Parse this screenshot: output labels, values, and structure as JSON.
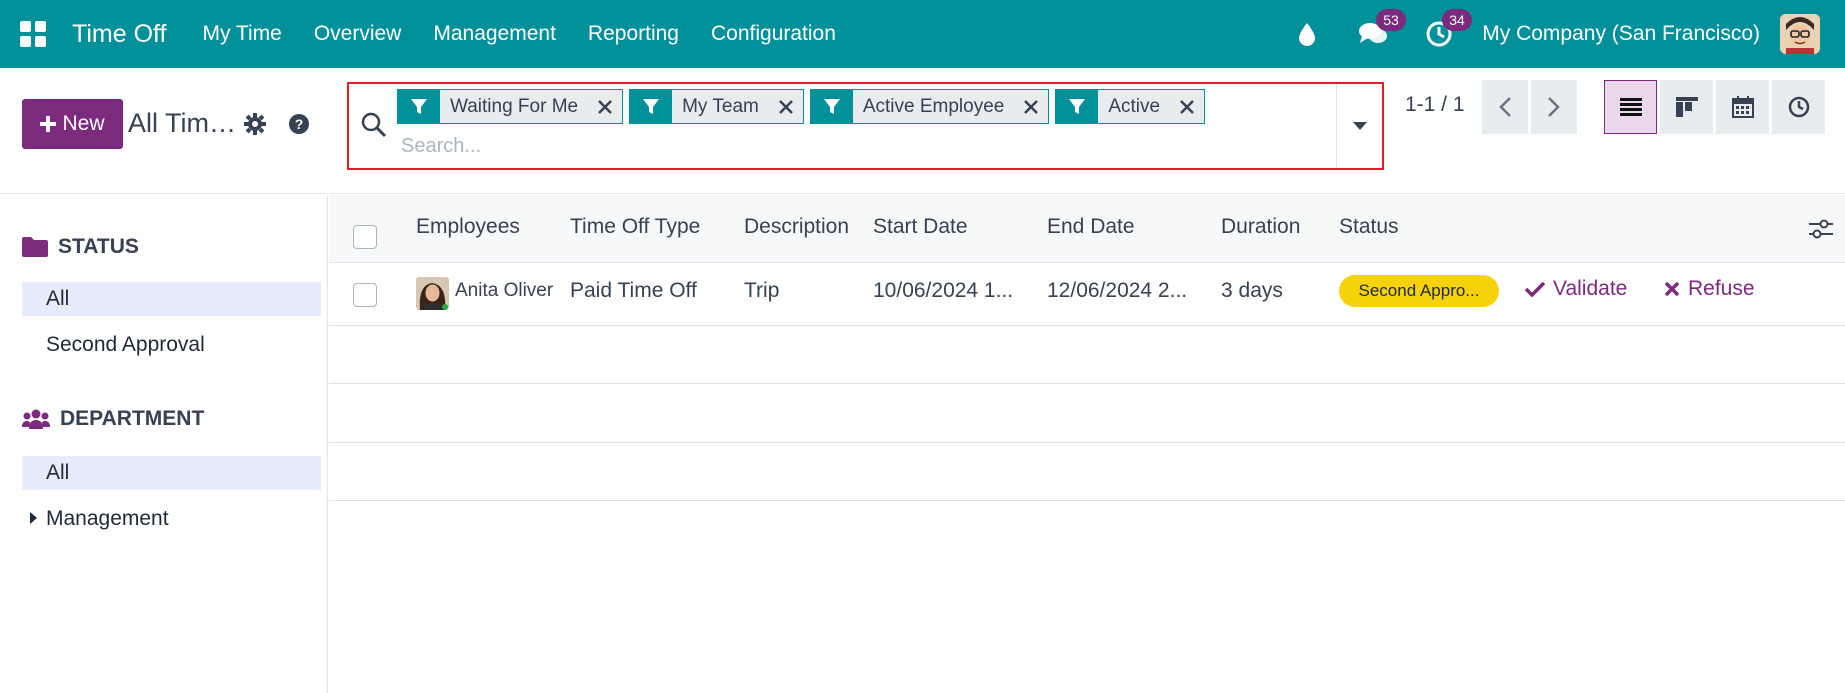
{
  "navbar": {
    "app_name": "Time Off",
    "menu": [
      "My Time",
      "Overview",
      "Management",
      "Reporting",
      "Configuration"
    ],
    "messages_count": "53",
    "activities_count": "34",
    "company": "My Company (San Francisco)",
    "icons": [
      "apps-grid-icon",
      "droplet-icon",
      "chat-icon",
      "clock-icon"
    ]
  },
  "control": {
    "new_label": "New",
    "breadcrumb": "All Time Off",
    "search": {
      "facets": [
        "Waiting For Me",
        "My Team",
        "Active Employee",
        "Active"
      ],
      "placeholder": "Search..."
    },
    "pager": "1-1 / 1"
  },
  "sidepanel": {
    "status_title": "STATUS",
    "status_items": [
      "All",
      "Second Approval"
    ],
    "department_title": "DEPARTMENT",
    "department_items": [
      "All",
      "Management"
    ]
  },
  "list": {
    "columns": [
      "Employees",
      "Time Off Type",
      "Description",
      "Start Date",
      "End Date",
      "Duration",
      "Status"
    ],
    "rows": [
      {
        "employee": "Anita Oliver",
        "type": "Paid Time Off",
        "description": "Trip",
        "start": "10/06/2024 1...",
        "end": "12/06/2024 2...",
        "duration": "3 days",
        "status": "Second Appro...",
        "validate_label": "Validate",
        "refuse_label": "Refuse"
      }
    ]
  },
  "colors": {
    "navbar": "#00909a",
    "primary": "#7c2a7e",
    "status_badge": "#f5d20a",
    "highlight": "#e01e24"
  }
}
